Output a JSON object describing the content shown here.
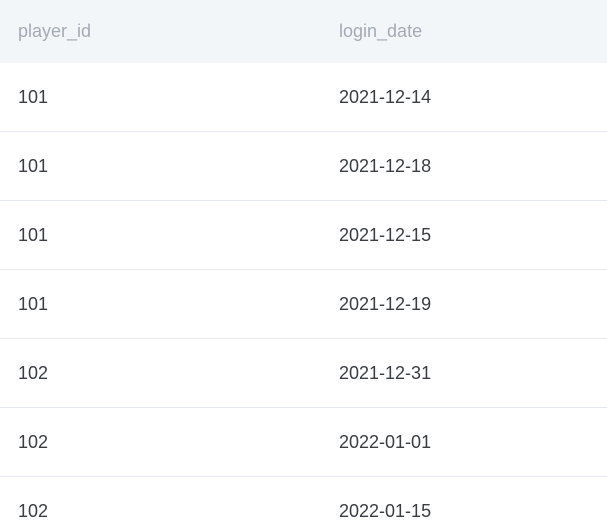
{
  "table": {
    "columns": [
      "player_id",
      "login_date"
    ],
    "rows": [
      [
        "101",
        "2021-12-14"
      ],
      [
        "101",
        "2021-12-18"
      ],
      [
        "101",
        "2021-12-15"
      ],
      [
        "101",
        "2021-12-19"
      ],
      [
        "102",
        "2021-12-31"
      ],
      [
        "102",
        "2022-01-01"
      ],
      [
        "102",
        "2022-01-15"
      ]
    ]
  },
  "colors": {
    "header_bg": "#f3f6f9",
    "header_text": "#a4abb4",
    "row_text": "#3a3d41",
    "row_divider": "#e5e8ec"
  }
}
